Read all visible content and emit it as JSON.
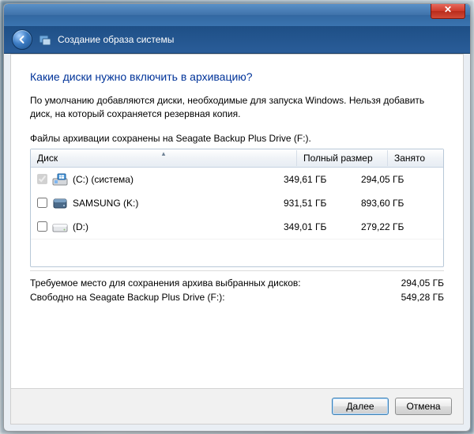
{
  "window": {
    "title": "Создание образа системы"
  },
  "main": {
    "heading": "Какие диски нужно включить в архивацию?",
    "description": "По умолчанию добавляются диски, необходимые для запуска Windows. Нельзя добавить диск, на который сохраняется резервная копия.",
    "storage_line": "Файлы архивации сохранены на Seagate Backup Plus Drive (F:)."
  },
  "table": {
    "headers": {
      "disk": "Диск",
      "size": "Полный размер",
      "used": "Занято"
    },
    "rows": [
      {
        "checked": true,
        "disabled": true,
        "label": "(C:) (система)",
        "size": "349,61 ГБ",
        "used": "294,05 ГБ",
        "icon": "win"
      },
      {
        "checked": false,
        "disabled": false,
        "label": "SAMSUNG (K:)",
        "size": "931,51 ГБ",
        "used": "893,60 ГБ",
        "icon": "ext"
      },
      {
        "checked": false,
        "disabled": false,
        "label": "(D:)",
        "size": "349,01 ГБ",
        "used": "279,22 ГБ",
        "icon": "hdd"
      }
    ]
  },
  "summary": {
    "required_label": "Требуемое место для сохранения архива выбранных дисков:",
    "required_value": "294,05 ГБ",
    "free_label": "Свободно на Seagate Backup Plus Drive (F:):",
    "free_value": "549,28 ГБ"
  },
  "buttons": {
    "next": "Далее",
    "cancel": "Отмена"
  }
}
